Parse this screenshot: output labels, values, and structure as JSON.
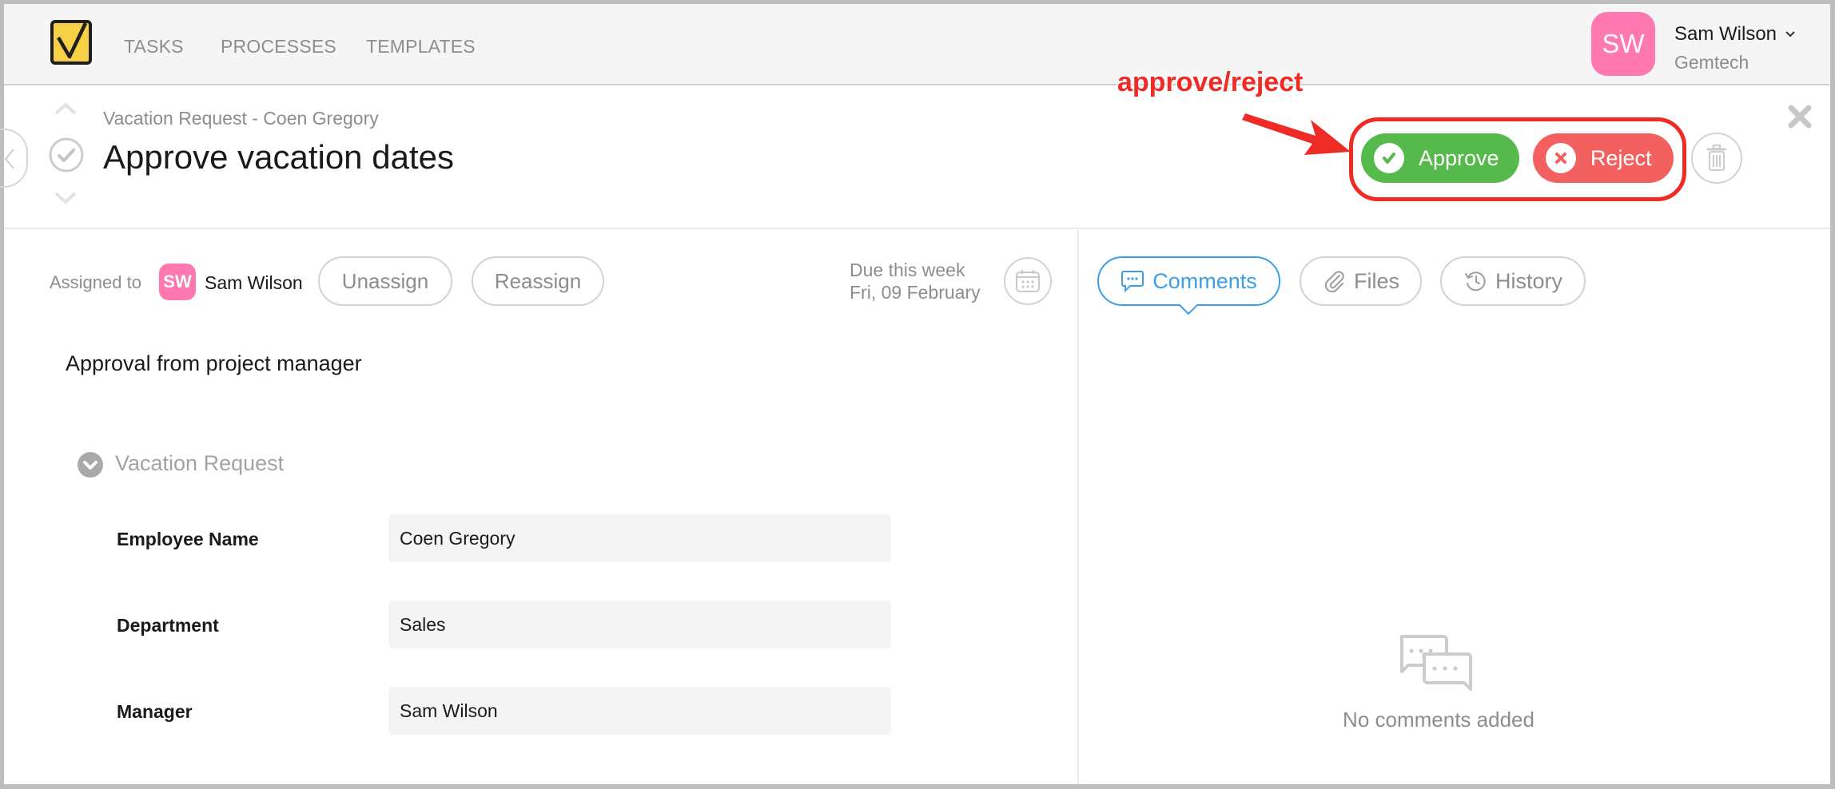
{
  "nav": {
    "items": [
      {
        "label": "TASKS"
      },
      {
        "label": "PROCESSES"
      },
      {
        "label": "TEMPLATES"
      }
    ],
    "user": {
      "initials": "SW",
      "name": "Sam Wilson",
      "organization": "Gemtech",
      "avatar_color": "#ff78b0"
    }
  },
  "task": {
    "breadcrumb": "Vacation Request - Coen Gregory",
    "title": "Approve vacation dates",
    "actions": {
      "approve_label": "Approve",
      "reject_label": "Reject"
    },
    "assignment": {
      "label": "Assigned to",
      "assignee_initials": "SW",
      "assignee_name": "Sam Wilson",
      "unassign_label": "Unassign",
      "reassign_label": "Reassign"
    },
    "due": {
      "status": "Due this week",
      "date": "Fri, 09 February"
    },
    "description": "Approval from project manager",
    "form": {
      "section_title": "Vacation Request",
      "fields": [
        {
          "label": "Employee Name",
          "value": "Coen Gregory"
        },
        {
          "label": "Department",
          "value": "Sales"
        },
        {
          "label": "Manager",
          "value": "Sam Wilson"
        }
      ]
    }
  },
  "side_panel": {
    "tabs": [
      {
        "label": "Comments",
        "active": true
      },
      {
        "label": "Files",
        "active": false
      },
      {
        "label": "History",
        "active": false
      }
    ],
    "empty_message": "No comments added"
  },
  "annotation": {
    "label": "approve/reject",
    "color": "#ee2b24"
  },
  "colors": {
    "approve": "#56b94b",
    "reject": "#f26060",
    "accent": "#3a9fe8",
    "logo": "#f7d046"
  }
}
